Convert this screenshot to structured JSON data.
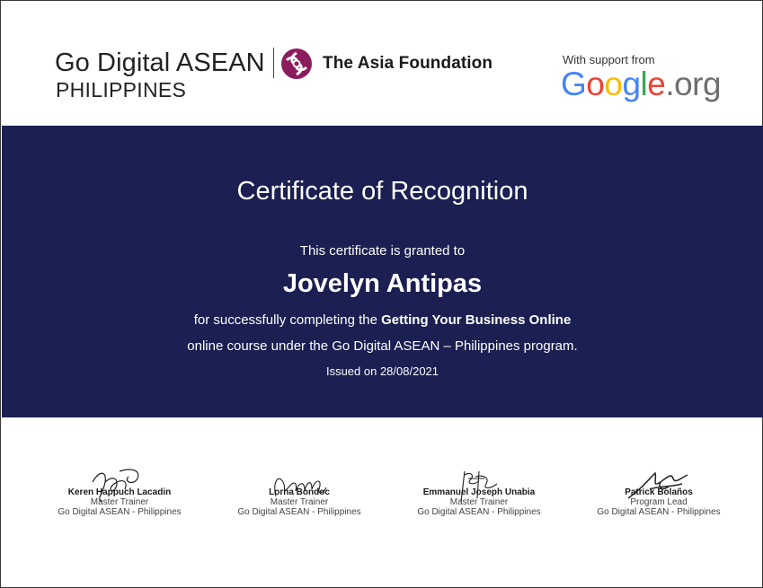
{
  "header": {
    "program_title": "Go Digital ASEAN",
    "program_country": "PHILIPPINES",
    "partner_name": "The Asia Foundation",
    "support_text": "With support from",
    "google_logo": {
      "G": "G",
      "o1": "o",
      "o2": "o",
      "g": "g",
      "l": "l",
      "e": "e",
      "org": ".org"
    },
    "colors": {
      "blue": "#4285F4",
      "red": "#EA4335",
      "yellow": "#FBBC05",
      "green": "#34A853",
      "taf": "#8b1d5e"
    }
  },
  "certificate": {
    "title": "Certificate of Recognition",
    "granted_text": "This certificate is granted to",
    "recipient": "Jovelyn Antipas",
    "line1_prefix": "for successfully completing the ",
    "course_name": "Getting Your Business Online",
    "line2": "online course under the Go Digital ASEAN – Philippines program.",
    "issued": "Issued on 28/08/2021",
    "band_color": "#1b1f51"
  },
  "signatories": [
    {
      "name": "Keren Happuch Lacadin",
      "role": "Master Trainer",
      "org": "Go Digital ASEAN - Philippines"
    },
    {
      "name": "Lorna Bondoc",
      "role": "Master Trainer",
      "org": "Go Digital ASEAN - Philippines"
    },
    {
      "name": "Emmanuel Joseph Unabia",
      "role": "Master Trainer",
      "org": "Go Digital ASEAN - Philippines"
    },
    {
      "name": "Patrick Bolaños",
      "role": "Program Lead",
      "org": "Go Digital ASEAN - Philippines"
    }
  ]
}
